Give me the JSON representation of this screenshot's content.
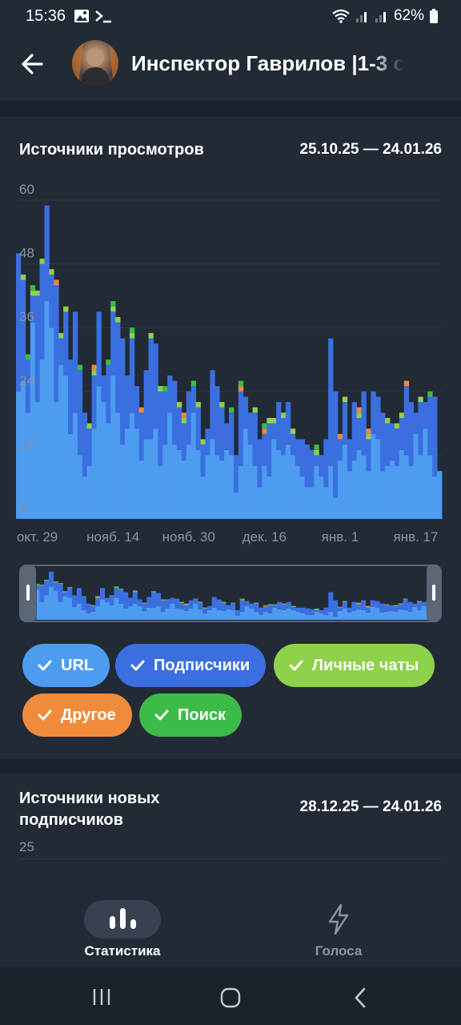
{
  "status": {
    "time": "15:36",
    "battery": "62%"
  },
  "header": {
    "title": "Инспектор Гаврилов |1-3 с"
  },
  "views_card": {
    "title": "Источники просмотров",
    "range": "25.10.25 — 24.01.26"
  },
  "subs_card": {
    "title_line1": "Источники новых",
    "title_line2": "подписчиков",
    "range": "28.12.25 — 24.01.26",
    "y_top": "25"
  },
  "legend": {
    "url": "URL",
    "subscribers": "Подписчики",
    "private_chats": "Личные чаты",
    "other": "Другое",
    "search": "Поиск"
  },
  "bottom_nav": {
    "stats": "Статистика",
    "votes": "Голоса"
  },
  "colors": {
    "url": "#4d9cf0",
    "subscribers": "#3b6fe0",
    "private_chats": "#8ed14a",
    "other": "#f08b3c",
    "search": "#3cbb48"
  },
  "chart_data": {
    "type": "bar",
    "stacked": true,
    "ylim": [
      0,
      60
    ],
    "yticks": [
      "0",
      "12",
      "24",
      "36",
      "48",
      "60"
    ],
    "xticks": [
      "окт. 29",
      "нояб. 14",
      "нояб. 30",
      "дек. 16",
      "янв. 1",
      "янв. 17"
    ],
    "xtick_index": [
      4,
      20,
      36,
      52,
      68,
      84
    ],
    "grid": true,
    "series": [
      {
        "name": "URL",
        "values": [
          24,
          26,
          20,
          37,
          22,
          30,
          41,
          36,
          22,
          29,
          27,
          16,
          20,
          12,
          8,
          10,
          17,
          25,
          22,
          18,
          27,
          20,
          14,
          17,
          20,
          17,
          11,
          15,
          15,
          17,
          10,
          14,
          20,
          14,
          13,
          11,
          14,
          20,
          13,
          8,
          12,
          15,
          12,
          11,
          13,
          12,
          5,
          10,
          17,
          14,
          10,
          6,
          10,
          8,
          15,
          13,
          12,
          14,
          12,
          10,
          8,
          6,
          6,
          10,
          8,
          6,
          10,
          4,
          11,
          14,
          9,
          11,
          13,
          12,
          9,
          16,
          15,
          9,
          10,
          11,
          10,
          13,
          12,
          10,
          16,
          12,
          17,
          12,
          8,
          9
        ]
      },
      {
        "name": "Подписчики",
        "values": [
          26,
          19,
          10,
          5,
          20,
          18,
          18,
          10,
          22,
          5,
          12,
          14,
          19,
          16,
          12,
          7,
          10,
          14,
          5,
          11,
          12,
          17,
          20,
          10,
          14,
          8,
          9,
          13,
          19,
          16,
          14,
          10,
          7,
          12,
          8,
          7,
          10,
          5,
          8,
          6,
          5,
          13,
          13,
          10,
          5,
          8,
          7,
          14,
          6,
          6,
          10,
          9,
          6,
          10,
          3,
          9,
          7,
          8,
          4,
          5,
          7,
          8,
          7,
          2,
          4,
          9,
          24,
          20,
          4,
          8,
          6,
          11,
          6,
          12,
          6,
          8,
          8,
          11,
          8,
          7,
          7,
          6,
          13,
          12,
          4,
          10,
          5,
          11,
          15,
          0
        ]
      },
      {
        "name": "Личные чаты",
        "values": [
          0,
          1,
          0,
          1,
          1,
          1,
          0,
          1,
          0,
          1,
          1,
          0,
          0,
          0,
          0,
          1,
          1,
          0,
          0,
          0,
          1,
          1,
          0,
          0,
          1,
          0,
          0,
          0,
          1,
          0,
          1,
          0,
          0,
          0,
          1,
          1,
          0,
          0,
          1,
          1,
          0,
          0,
          0,
          1,
          0,
          0,
          0,
          0,
          0,
          0,
          1,
          0,
          0,
          1,
          1,
          0,
          1,
          0,
          1,
          0,
          0,
          0,
          0,
          1,
          0,
          0,
          0,
          0,
          0,
          1,
          0,
          0,
          1,
          0,
          1,
          0,
          0,
          0,
          1,
          0,
          1,
          1,
          0,
          0,
          0,
          1,
          0,
          0,
          0,
          0
        ]
      },
      {
        "name": "Другое",
        "values": [
          0,
          0,
          0,
          0,
          0,
          0,
          0,
          0,
          1,
          0,
          0,
          0,
          0,
          0,
          0,
          0,
          1,
          0,
          0,
          0,
          0,
          0,
          0,
          0,
          0,
          0,
          1,
          0,
          0,
          0,
          0,
          0,
          0,
          0,
          0,
          1,
          0,
          0,
          0,
          0,
          0,
          0,
          0,
          0,
          0,
          0,
          0,
          1,
          0,
          0,
          0,
          0,
          1,
          0,
          0,
          0,
          0,
          0,
          0,
          0,
          0,
          0,
          0,
          0,
          0,
          0,
          0,
          0,
          1,
          0,
          0,
          0,
          1,
          0,
          1,
          0,
          0,
          0,
          0,
          0,
          0,
          0,
          1,
          0,
          0,
          0,
          0,
          0,
          0,
          0
        ]
      },
      {
        "name": "Поиск",
        "values": [
          0,
          0,
          1,
          1,
          0,
          0,
          0,
          0,
          0,
          0,
          0,
          0,
          0,
          1,
          0,
          0,
          0,
          0,
          0,
          1,
          1,
          0,
          0,
          0,
          1,
          0,
          0,
          0,
          0,
          0,
          0,
          1,
          0,
          0,
          0,
          0,
          0,
          1,
          0,
          0,
          0,
          0,
          0,
          0,
          0,
          1,
          0,
          1,
          0,
          0,
          0,
          0,
          1,
          0,
          0,
          0,
          0,
          0,
          0,
          0,
          0,
          0,
          0,
          1,
          0,
          0,
          0,
          0,
          0,
          0,
          0,
          0,
          0,
          0,
          0,
          0,
          0,
          0,
          0,
          0,
          0,
          0,
          0,
          0,
          0,
          0,
          0,
          1,
          0,
          0
        ]
      }
    ]
  }
}
